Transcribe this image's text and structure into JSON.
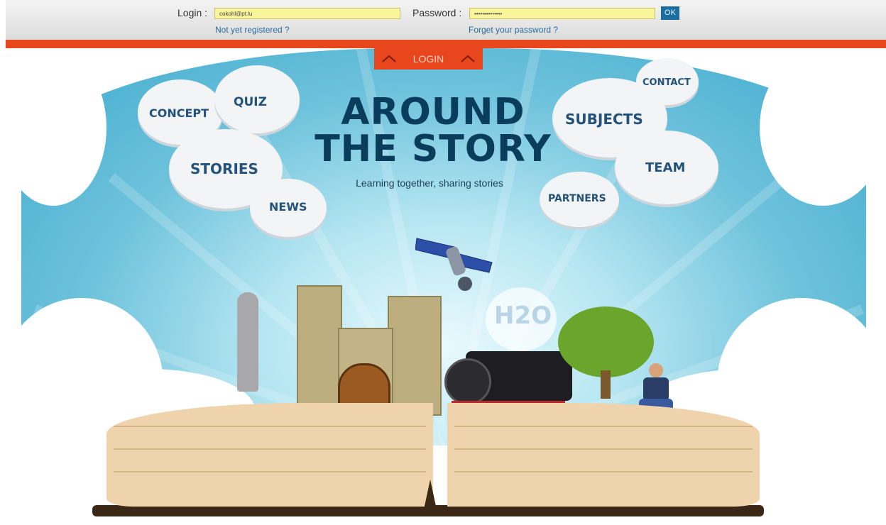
{
  "login_bar": {
    "login_label": "Login :",
    "login_value": "cokohl@pt.lu",
    "password_label": "Password :",
    "password_value": "••••••••••••••",
    "ok_label": "OK",
    "register_link": "Not yet registered ?",
    "forgot_link": "Forget your password ?"
  },
  "login_tab": {
    "label": "LOGIN"
  },
  "site": {
    "title_line1": "AROUND",
    "title_line2": "THE STORY",
    "tagline": "Learning together, sharing stories"
  },
  "nav": {
    "concept": "CONCEPT",
    "quiz": "QUIZ",
    "stories": "STORIES",
    "news": "NEWS",
    "subjects": "SUBJECTS",
    "contact": "CONTACT",
    "team": "TEAM",
    "partners": "PARTNERS"
  },
  "illustration": {
    "h2o_text": "H2O"
  },
  "colors": {
    "accent": "#e8471e",
    "field": "#f8f59a",
    "link": "#2a6d9c",
    "title": "#0a3d5c"
  }
}
